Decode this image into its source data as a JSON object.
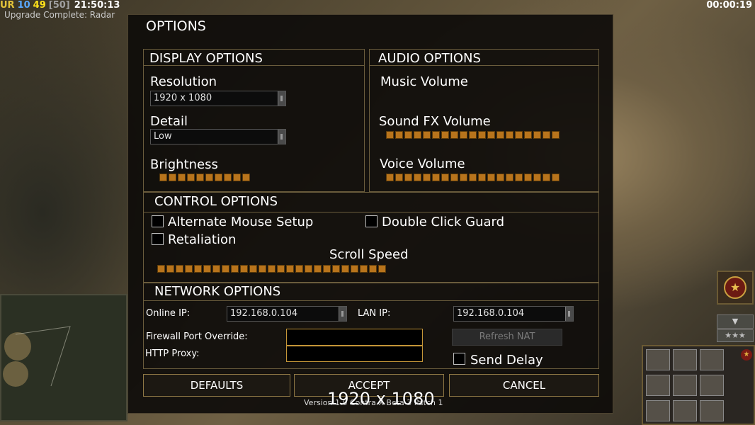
{
  "hud": {
    "faction": "UR",
    "value_a": "10",
    "value_b": "49",
    "value_c": "[50]",
    "clock": "21:50:13",
    "upgrade_text": "Upgrade Complete: Radar",
    "timer": "00:00:19",
    "colors": {
      "faction": "#e3c33a",
      "value_a": "#5aa9ff",
      "value_b": "#ffe21a",
      "value_c": "#a0a0a0"
    },
    "rank_icon": "star-rank-icon",
    "stars": "★★★"
  },
  "dialog": {
    "title": "OPTIONS",
    "display": {
      "title": "DISPLAY OPTIONS",
      "resolution_label": "Resolution",
      "resolution_value": "1920 x 1080",
      "detail_label": "Detail",
      "detail_value": "Low",
      "brightness_label": "Brightness",
      "brightness_segments": 10
    },
    "audio": {
      "title": "AUDIO OPTIONS",
      "music_label": "Music Volume",
      "music_segments": 0,
      "sfx_label": "Sound FX Volume",
      "sfx_segments": 19,
      "voice_label": "Voice Volume",
      "voice_segments": 19
    },
    "control": {
      "title": "CONTROL OPTIONS",
      "alt_mouse_label": "Alternate Mouse Setup",
      "double_click_label": "Double Click Guard",
      "retaliation_label": "Retaliation",
      "scroll_label": "Scroll Speed",
      "scroll_segments": 25
    },
    "network": {
      "title": "NETWORK OPTIONS",
      "online_ip_label": "Online IP:",
      "online_ip_value": "192.168.0.104",
      "lan_ip_label": "LAN IP:",
      "lan_ip_value": "192.168.0.104",
      "firewall_label": "Firewall Port Override:",
      "http_proxy_label": "HTTP Proxy:",
      "refresh_nat_label": "Refresh NAT",
      "send_delay_label": "Send Delay"
    },
    "buttons": {
      "defaults": "DEFAULTS",
      "accept": "ACCEPT",
      "cancel": "CANCEL"
    },
    "version": "Version 1.0 Contra X Beta 3 Patch 1",
    "resolution_overlay": "1920 x 1080",
    "slider_color": "#b8741c",
    "accent_border": "#c49538"
  }
}
